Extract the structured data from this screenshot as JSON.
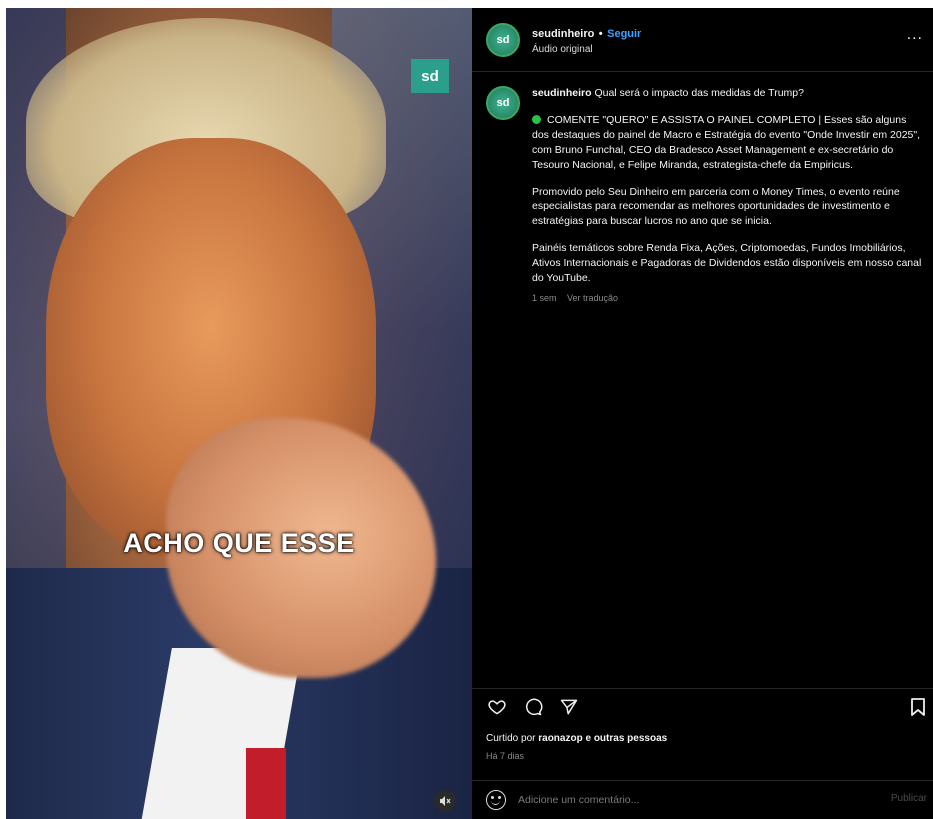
{
  "media": {
    "caption": "ACHO QUE ESSE",
    "logo_text": "sd",
    "mute_icon": "speaker-muted-icon"
  },
  "header": {
    "avatar_text": "sd",
    "username": "seudinheiro",
    "separator": "•",
    "follow_label": "Seguir",
    "audio": "Áudio original",
    "more": "..."
  },
  "post": {
    "avatar_text": "sd",
    "username": "seudinheiro",
    "headline": "Qual será o impacto das medidas de Trump?",
    "para1": "COMENTE \"QUERO\" E ASSISTA O PAINEL COMPLETO | Esses são alguns dos destaques do painel de Macro e Estratégia do evento \"Onde Investir em 2025\", com Bruno Funchal, CEO da Bradesco Asset Management e ex-secretário do Tesouro Nacional, e Felipe Miranda, estrategista-chefe da Empiricus.",
    "para2": "Promovido pelo Seu Dinheiro em parceria com o Money Times, o evento reúne especialistas para recomendar as melhores oportunidades de investimento e estratégias para buscar lucros no ano que se inicia.",
    "para3": "Painéis temáticos sobre Renda Fixa, Ações, Criptomoedas, Fundos Imobiliários, Ativos Internacionais e Pagadoras de Dividendos estão disponíveis em nosso canal do YouTube.",
    "age": "1 sem",
    "translate": "Ver tradução"
  },
  "actions": {
    "like_icon": "heart-icon",
    "comment_icon": "comment-icon",
    "share_icon": "share-icon",
    "save_icon": "bookmark-icon"
  },
  "likes": {
    "prefix": "Curtido por",
    "user": "raonazop",
    "suffix": "e outras pessoas"
  },
  "date": "Há 7 dias",
  "comment": {
    "placeholder": "Adicione um comentário...",
    "publish": "Publicar"
  }
}
